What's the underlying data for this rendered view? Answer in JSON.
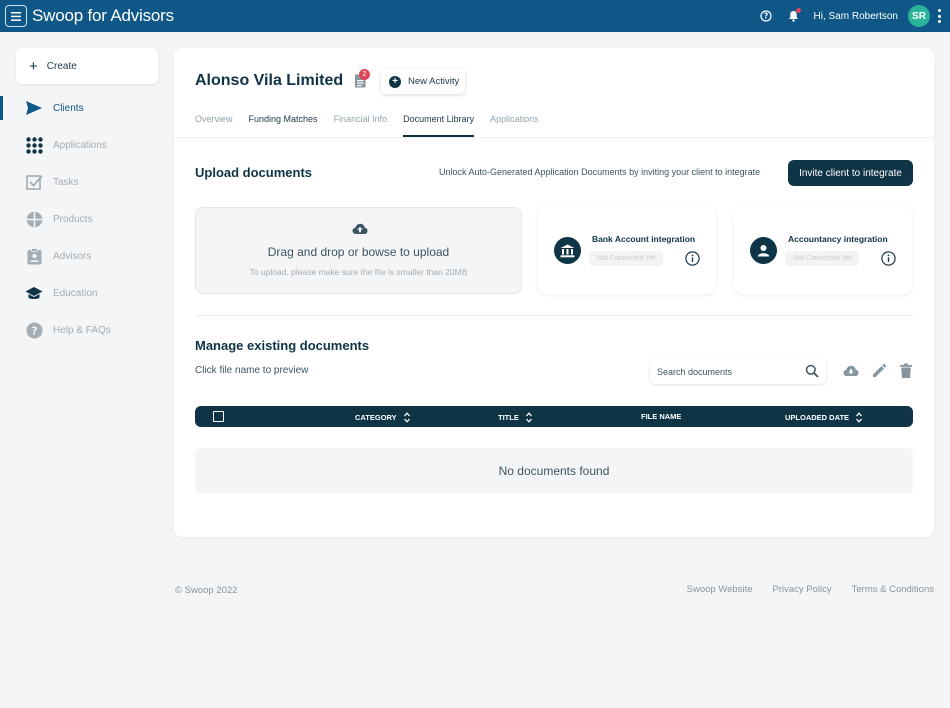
{
  "topbar": {
    "app_title": "Swoop for Advisors",
    "greeting": "Hi, Sam Robertson",
    "avatar_initials": "SR",
    "brand_color": "#0e5787",
    "icons": [
      "menu-icon",
      "help-icon",
      "bell-icon",
      "kebab-icon"
    ]
  },
  "sidebar": {
    "create_label": "Create",
    "items": [
      {
        "label": "Clients",
        "icon": "send-icon",
        "active": true
      },
      {
        "label": "Applications",
        "icon": "grid-icon",
        "active": false
      },
      {
        "label": "Tasks",
        "icon": "checkbox-icon",
        "active": false
      },
      {
        "label": "Products",
        "icon": "pie-icon",
        "active": false
      },
      {
        "label": "Advisors",
        "icon": "clipboard-user-icon",
        "active": false
      },
      {
        "label": "Education",
        "icon": "graduation-cap-icon",
        "active": false
      },
      {
        "label": "Help & FAQs",
        "icon": "question-icon",
        "active": false
      }
    ]
  },
  "client": {
    "name": "Alonso Vila Limited",
    "doc_badge_count": "2",
    "new_activity_label": "New Activity"
  },
  "tabs": [
    {
      "label": "Overview",
      "state": "default"
    },
    {
      "label": "Funding Matches",
      "state": "dark"
    },
    {
      "label": "Financial Info",
      "state": "default"
    },
    {
      "label": "Document Library",
      "state": "active"
    },
    {
      "label": "Applications",
      "state": "default"
    }
  ],
  "upload": {
    "heading": "Upload documents",
    "unlock_text": "Unlock Auto-Generated Application Documents by inviting your client to integrate",
    "invite_label": "Invite client to integrate",
    "dropzone_main": "Drag and drop or bowse to upload",
    "dropzone_sub": "To upload, please make sure the file is smaller than 20MB"
  },
  "integrations": [
    {
      "title": "Bank Account integration",
      "status": "Not Connected Yet",
      "icon": "bank-icon"
    },
    {
      "title": "Accountancy integration",
      "status": "Not Connected Yet",
      "icon": "user-icon"
    }
  ],
  "manage": {
    "heading": "Manage existing documents",
    "preview_hint": "Click file name to preview",
    "search_placeholder": "Search documents",
    "tools": [
      "download-icon",
      "edit-icon",
      "delete-icon"
    ]
  },
  "table": {
    "columns": [
      "CATEGORY",
      "TITLE",
      "FILE NAME",
      "UPLOADED DATE"
    ],
    "empty_text": "No documents found"
  },
  "footer": {
    "copyright": "© Swoop 2022",
    "links": [
      "Swoop Website",
      "Privacy Policy",
      "Terms & Conditions"
    ]
  }
}
